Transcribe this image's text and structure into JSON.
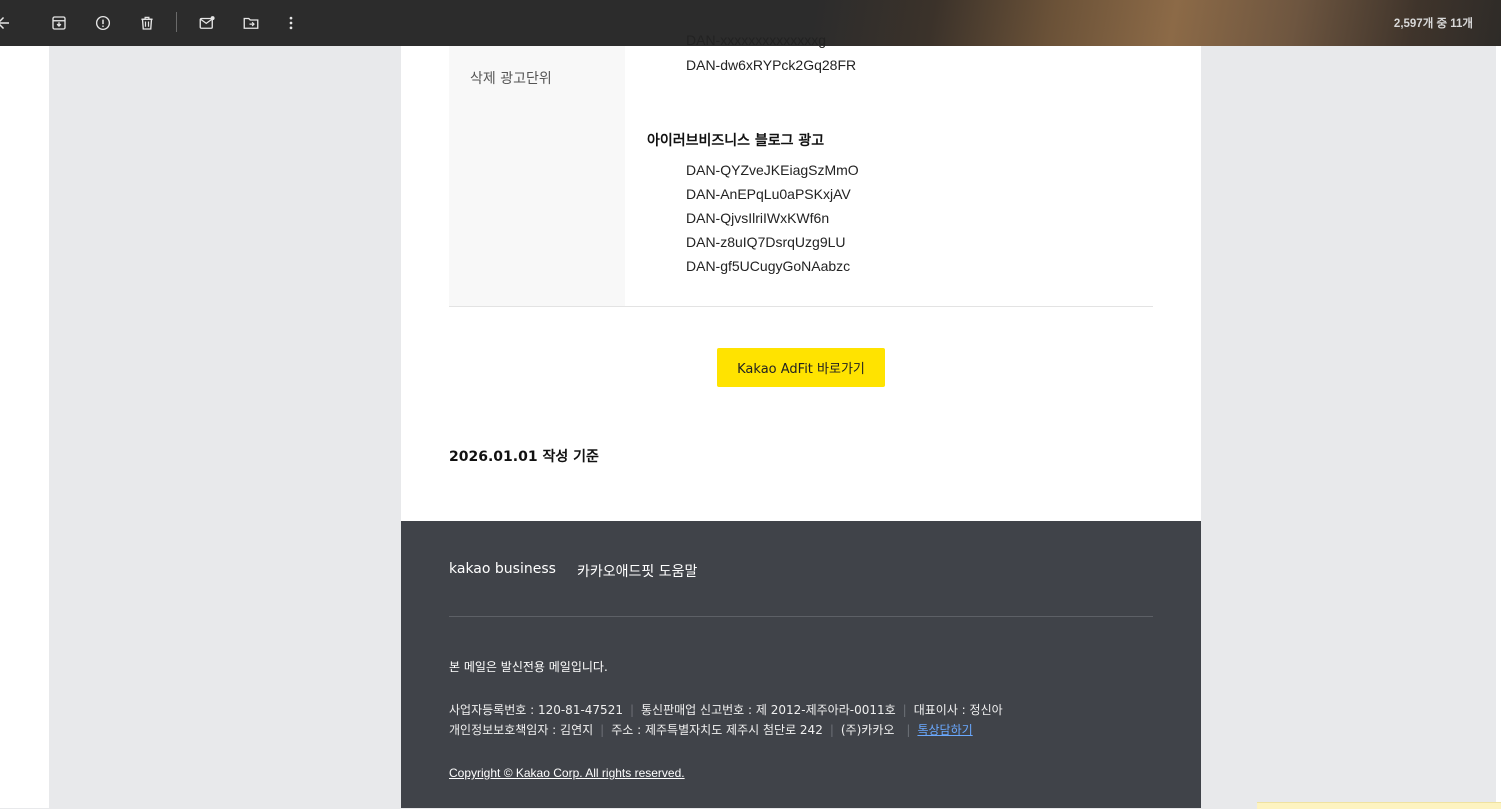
{
  "toolbar": {
    "counter": "2,597개 중 11개",
    "icons": [
      "back-arrow-icon",
      "archive-icon",
      "report-spam-icon",
      "trash-icon",
      "mark-unread-icon",
      "move-to-icon",
      "more-vert-icon"
    ]
  },
  "content": {
    "deleted_label": "삭제 광고단위",
    "partial_unit": "DAN-xxxxxxxxxxxxxxg",
    "first_units": [
      "DAN-dw6xRYPck2Gq28FR"
    ],
    "group_title": "아이러브비즈니스 블로그 광고",
    "group_units": [
      "DAN-QYZveJKEiagSzMmO",
      "DAN-AnEPqLu0aPSKxjAV",
      "DAN-QjvsIlriIWxKWf6n",
      "DAN-z8uIQ7DsrqUzg9LU",
      "DAN-gf5UCugyGoNAabzc"
    ],
    "cta_label": "Kakao AdFit 바로가기",
    "date_note": "2026.01.01 작성 기준"
  },
  "footer": {
    "link_business": "kakao business",
    "link_help": "카카오애드핏 도움말",
    "notice": "본 메일은 발신전용 메일입니다.",
    "biz_no": "사업자등록번호 : 120-81-47521",
    "mail_order_no": "통신판매업 신고번호 : 제 2012-제주아라-0011호",
    "ceo": "대표이사 : 정신아",
    "privacy_officer": "개인정보보호책임자 : 김연지",
    "address": "주소 : 제주특별자치도 제주시 첨단로 242",
    "company": "(주)카카오",
    "consult_link": "톡상담하기",
    "copyright": "Copyright © Kakao Corp. All rights reserved."
  },
  "colors": {
    "cta_bg": "#ffe300",
    "footer_bg": "#404349",
    "link_blue": "#6aa9ff"
  }
}
